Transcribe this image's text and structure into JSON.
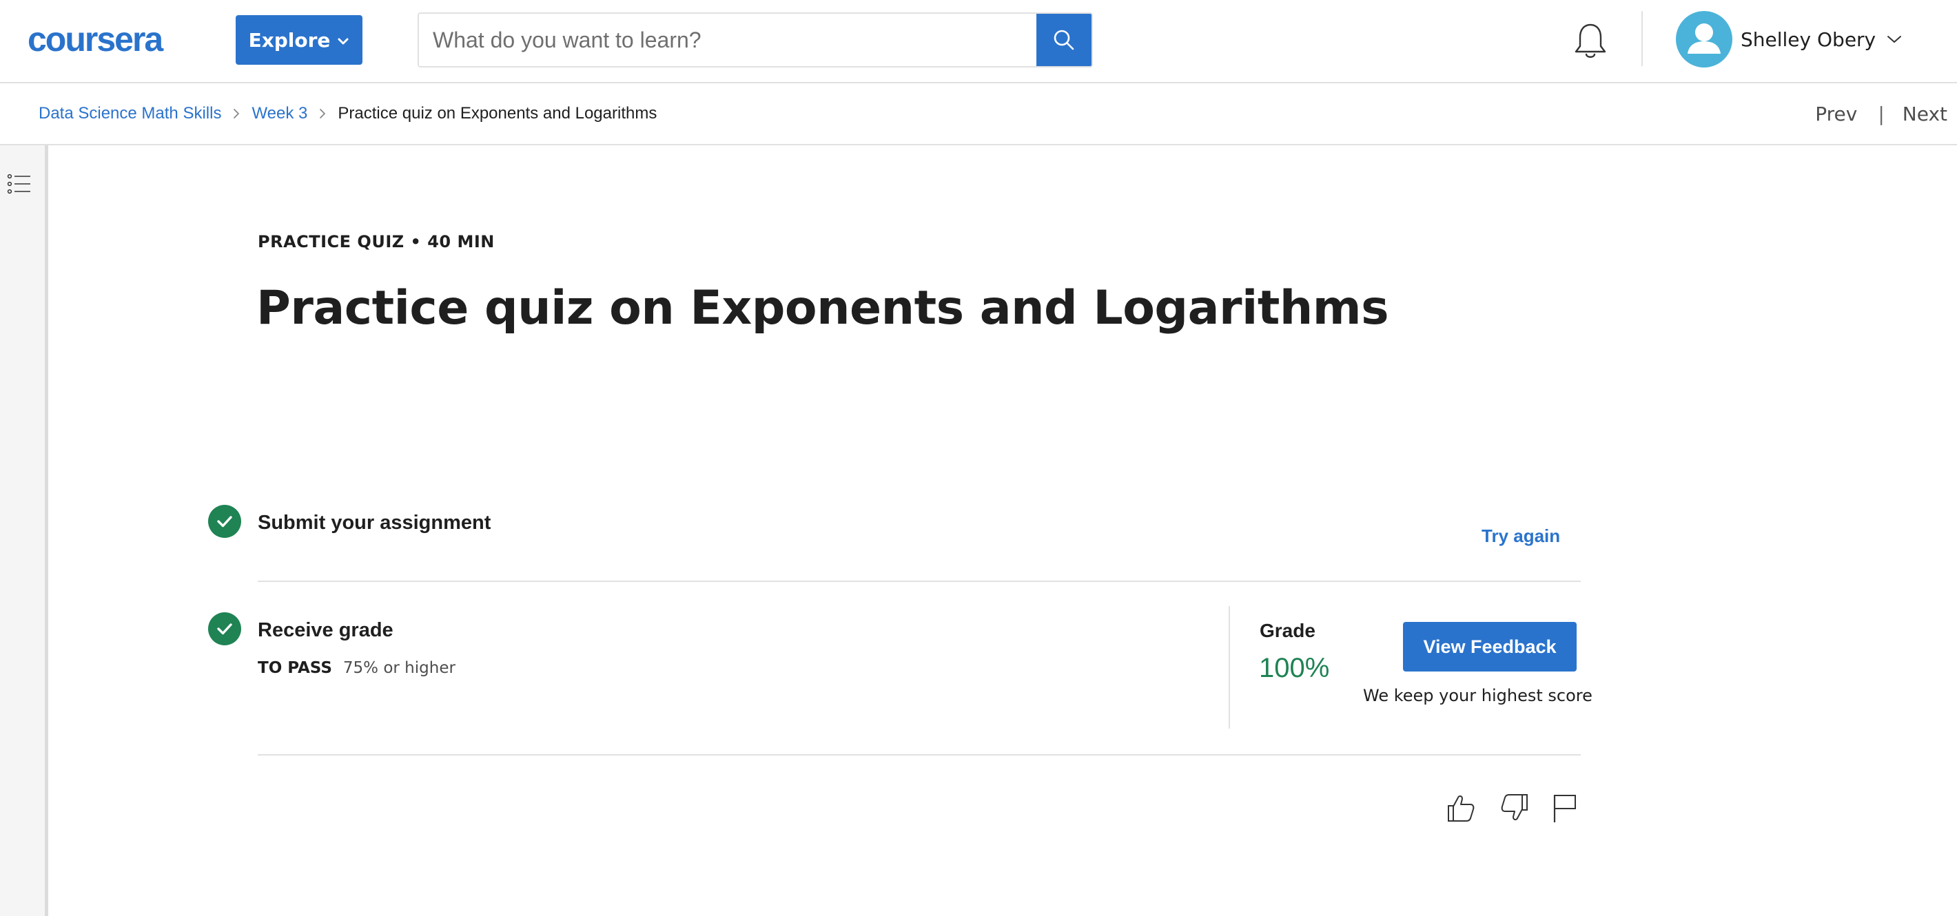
{
  "header": {
    "logo_text": "coursera",
    "explore_label": "Explore",
    "search_placeholder": "What do you want to learn?",
    "user_name": "Shelley Obery",
    "icons": [
      "search-icon",
      "bell-icon",
      "user-avatar-icon",
      "chevron-down-icon"
    ]
  },
  "breadcrumb": {
    "items": [
      "Data Science Math Skills",
      "Week 3"
    ],
    "current": "Practice quiz on Exponents and Logarithms"
  },
  "nav": {
    "prev": "Prev",
    "separator": "|",
    "next": "Next"
  },
  "quiz": {
    "kicker": "PRACTICE QUIZ • 40 MIN",
    "title": "Practice quiz on Exponents and Logarithms"
  },
  "steps": {
    "submit": {
      "title": "Submit your assignment",
      "action": "Try again"
    },
    "receive": {
      "title": "Receive grade",
      "pass_label": "TO PASS",
      "pass_value": "75% or higher"
    }
  },
  "grade": {
    "label": "Grade",
    "value": "100%",
    "button": "View Feedback",
    "note": "We keep your highest score"
  },
  "feedback_icons": [
    "thumbs-up-icon",
    "thumbs-down-icon",
    "flag-icon"
  ],
  "colors": {
    "brand_blue": "#2a73cc",
    "success_green": "#1f8354",
    "avatar_blue": "#4bb3d9",
    "divider": "#e1e1e1"
  }
}
